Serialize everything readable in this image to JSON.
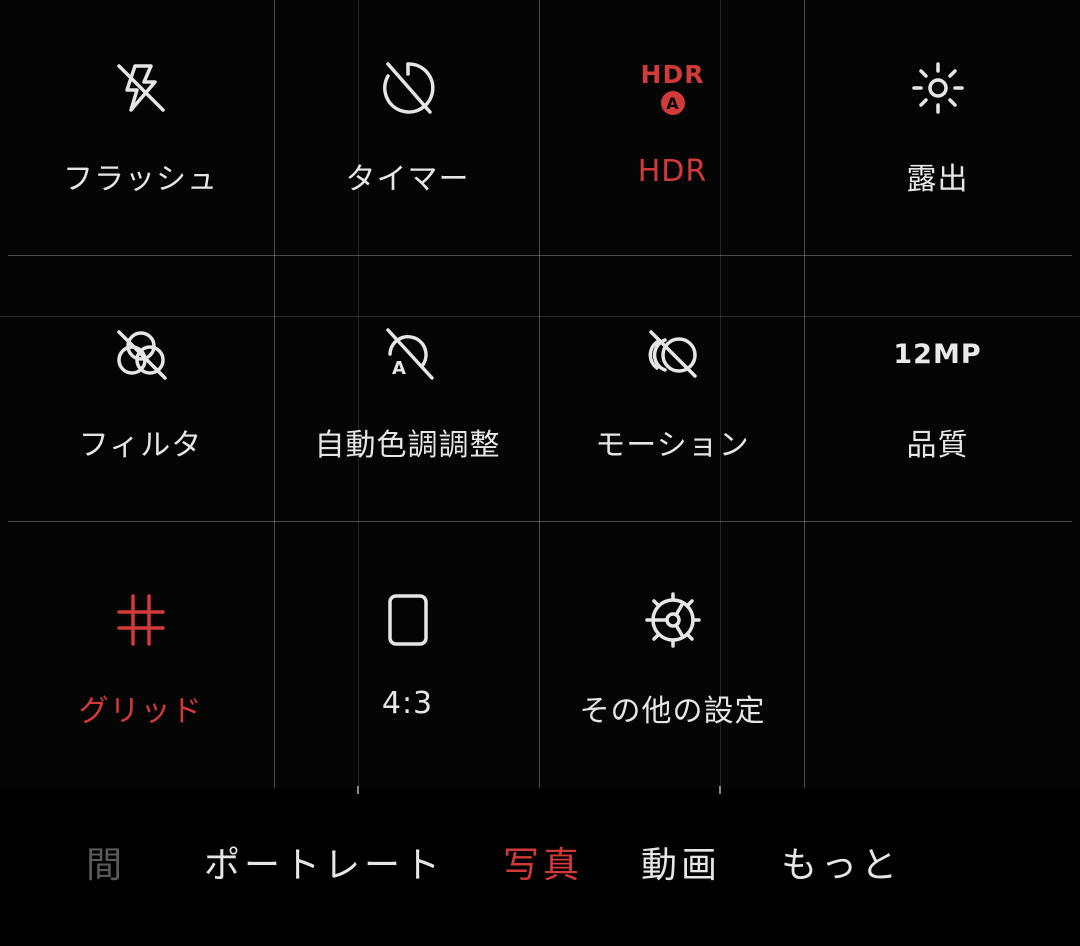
{
  "quick_settings": [
    {
      "label": "フラッシュ",
      "icon": "flash-off-icon",
      "active": false
    },
    {
      "label": "タイマー",
      "icon": "timer-off-icon",
      "active": false
    },
    {
      "label": "HDR",
      "icon": "hdr-auto-icon",
      "icon_text": "HDR",
      "icon_badge": "A",
      "active": true
    },
    {
      "label": "露出",
      "icon": "exposure-sun-icon",
      "active": false
    },
    {
      "label": "フィルタ",
      "icon": "filter-off-icon",
      "active": false
    },
    {
      "label": "自動色調調整",
      "icon": "auto-tone-off-icon",
      "active": false
    },
    {
      "label": "モーション",
      "icon": "motion-off-icon",
      "active": false
    },
    {
      "label": "品質",
      "icon": "quality-icon",
      "icon_text": "12MP",
      "active": false
    },
    {
      "label": "グリッド",
      "icon": "grid-icon",
      "active": true
    },
    {
      "label": "4:3",
      "icon": "aspect-ratio-icon",
      "active": false
    },
    {
      "label": "その他の設定",
      "icon": "settings-gear-icon",
      "active": false
    }
  ],
  "modes": [
    {
      "label": "間",
      "faded": true
    },
    {
      "label": "ポートレート",
      "active": false
    },
    {
      "label": "写真",
      "active": true
    },
    {
      "label": "動画",
      "active": false
    },
    {
      "label": "もっと",
      "active": false
    }
  ],
  "colors": {
    "accent": "#d23a3a",
    "text": "#e6e6e6",
    "background": "#050505"
  }
}
